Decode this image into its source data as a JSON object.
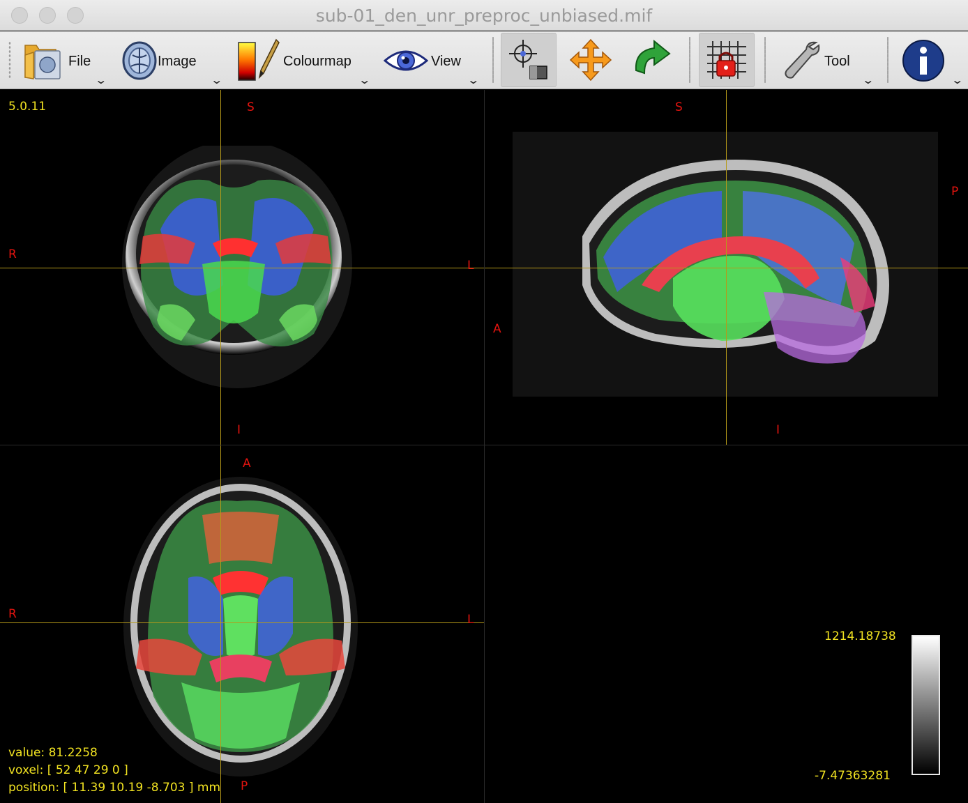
{
  "window": {
    "title": "sub-01_den_unr_preproc_unbiased.mif"
  },
  "toolbar": {
    "file_label": "File",
    "image_label": "Image",
    "colourmap_label": "Colourmap",
    "view_label": "View",
    "tool_label": "Tool",
    "icons": [
      "folder-icon",
      "brain-image-icon",
      "colourmap-icon",
      "eye-icon",
      "crosshair-mode-icon",
      "move-icon",
      "rotate-icon",
      "lock-grid-icon",
      "wrench-icon",
      "info-icon"
    ],
    "active_buttons": [
      "crosshair-mode",
      "lock-grid"
    ],
    "chevron": "⌄"
  },
  "viewer": {
    "version": "5.0.11",
    "coronal": {
      "top": "S",
      "bottom": "I",
      "left": "R",
      "right": "L"
    },
    "sagittal": {
      "top": "S",
      "bottom": "I",
      "left": "A",
      "right": "P"
    },
    "axial": {
      "top": "A",
      "bottom": "P",
      "left": "R",
      "right": "L"
    },
    "readout": {
      "value": "value: 81.2258",
      "voxel": "voxel: [ 52 47 29 0 ]",
      "position": "position: [ 11.39 10.19 -8.703 ] mm"
    },
    "colorbar": {
      "max": "1214.18738",
      "min": "-7.47363281"
    },
    "colors": {
      "orientation_label": "#e4140f",
      "overlay_text": "#f2e321",
      "crosshair": "#b59a1a"
    }
  }
}
